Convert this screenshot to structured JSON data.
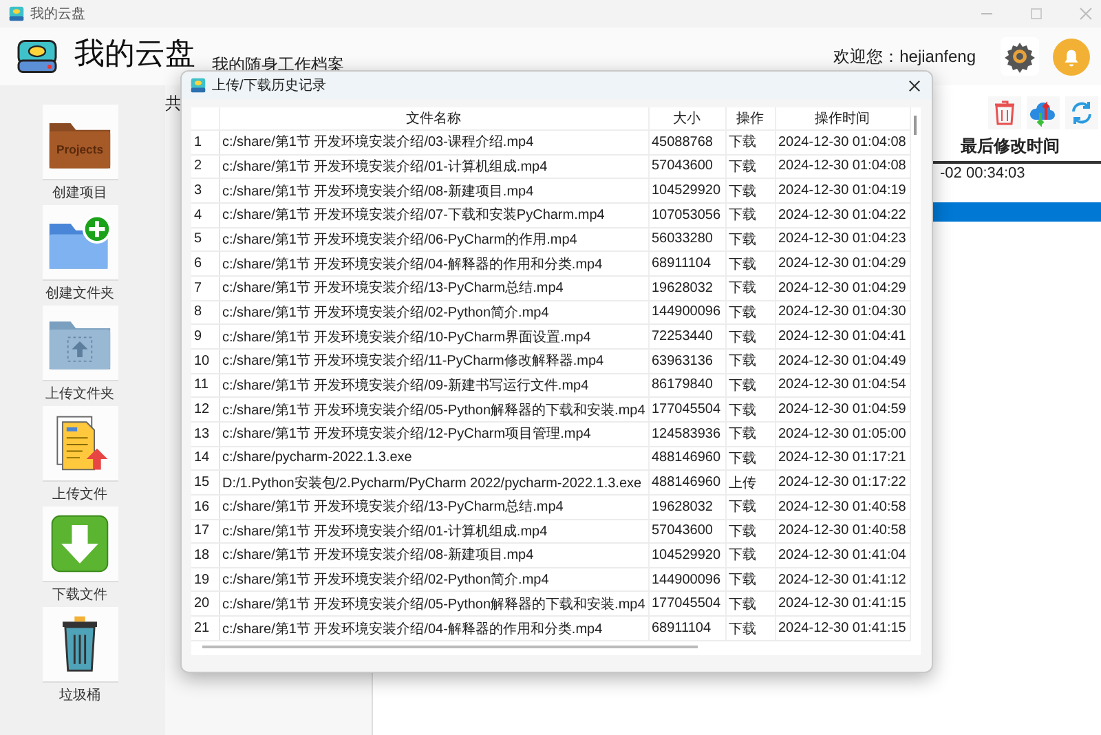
{
  "window": {
    "title": "我的云盘"
  },
  "header": {
    "title": "我的云盘",
    "subtitle": "我的随身工作档案",
    "welcome": "欢迎您：hejianfeng"
  },
  "toolbar": [
    {
      "label": "创建项目",
      "kind": "projects",
      "icon_text": "Projects"
    },
    {
      "label": "创建文件夹",
      "kind": "new-folder"
    },
    {
      "label": "上传文件夹",
      "kind": "upload-folder"
    },
    {
      "label": "上传文件",
      "kind": "upload-file"
    },
    {
      "label": "下载文件",
      "kind": "download"
    },
    {
      "label": "垃圾桶",
      "kind": "trash"
    }
  ],
  "shared_panel": {
    "heading": "共"
  },
  "file_list": {
    "columns": [
      "最后修改时间"
    ],
    "rows": [
      {
        "modified": "-02 00:34:03",
        "selected": false
      },
      {
        "selected": false
      },
      {
        "selected": true
      }
    ]
  },
  "dialog": {
    "title": "上传/下载历史记录",
    "columns": [
      "文件名称",
      "大小",
      "操作",
      "操作时间"
    ],
    "rows": [
      {
        "index": "1",
        "name": "c:/share/第1节 开发环境安装介绍/03-课程介绍.mp4",
        "size": "45088768",
        "action": "下载",
        "time": "2024-12-30 01:04:08"
      },
      {
        "index": "2",
        "name": "c:/share/第1节 开发环境安装介绍/01-计算机组成.mp4",
        "size": "57043600",
        "action": "下载",
        "time": "2024-12-30 01:04:08"
      },
      {
        "index": "3",
        "name": "c:/share/第1节 开发环境安装介绍/08-新建项目.mp4",
        "size": "104529920",
        "action": "下载",
        "time": "2024-12-30 01:04:19"
      },
      {
        "index": "4",
        "name": "c:/share/第1节 开发环境安装介绍/07-下载和安装PyCharm.mp4",
        "size": "107053056",
        "action": "下载",
        "time": "2024-12-30 01:04:22"
      },
      {
        "index": "5",
        "name": "c:/share/第1节 开发环境安装介绍/06-PyCharm的作用.mp4",
        "size": "56033280",
        "action": "下载",
        "time": "2024-12-30 01:04:23"
      },
      {
        "index": "6",
        "name": "c:/share/第1节 开发环境安装介绍/04-解释器的作用和分类.mp4",
        "size": "68911104",
        "action": "下载",
        "time": "2024-12-30 01:04:29"
      },
      {
        "index": "7",
        "name": "c:/share/第1节 开发环境安装介绍/13-PyCharm总结.mp4",
        "size": "19628032",
        "action": "下载",
        "time": "2024-12-30 01:04:29"
      },
      {
        "index": "8",
        "name": "c:/share/第1节 开发环境安装介绍/02-Python简介.mp4",
        "size": "144900096",
        "action": "下载",
        "time": "2024-12-30 01:04:30"
      },
      {
        "index": "9",
        "name": "c:/share/第1节 开发环境安装介绍/10-PyCharm界面设置.mp4",
        "size": "72253440",
        "action": "下载",
        "time": "2024-12-30 01:04:41"
      },
      {
        "index": "10",
        "name": "c:/share/第1节 开发环境安装介绍/11-PyCharm修改解释器.mp4",
        "size": "63963136",
        "action": "下载",
        "time": "2024-12-30 01:04:49"
      },
      {
        "index": "11",
        "name": "c:/share/第1节 开发环境安装介绍/09-新建书写运行文件.mp4",
        "size": "86179840",
        "action": "下载",
        "time": "2024-12-30 01:04:54"
      },
      {
        "index": "12",
        "name": "c:/share/第1节 开发环境安装介绍/05-Python解释器的下载和安装.mp4",
        "size": "177045504",
        "action": "下载",
        "time": "2024-12-30 01:04:59"
      },
      {
        "index": "13",
        "name": "c:/share/第1节 开发环境安装介绍/12-PyCharm项目管理.mp4",
        "size": "124583936",
        "action": "下载",
        "time": "2024-12-30 01:05:00"
      },
      {
        "index": "14",
        "name": "c:/share/pycharm-2022.1.3.exe",
        "size": "488146960",
        "action": "下载",
        "time": "2024-12-30 01:17:21"
      },
      {
        "index": "15",
        "name": "D:/1.Python安装包/2.Pycharm/PyCharm 2022/pycharm-2022.1.3.exe",
        "size": "488146960",
        "action": "上传",
        "time": "2024-12-30 01:17:22"
      },
      {
        "index": "16",
        "name": "c:/share/第1节 开发环境安装介绍/13-PyCharm总结.mp4",
        "size": "19628032",
        "action": "下载",
        "time": "2024-12-30 01:40:58"
      },
      {
        "index": "17",
        "name": "c:/share/第1节 开发环境安装介绍/01-计算机组成.mp4",
        "size": "57043600",
        "action": "下载",
        "time": "2024-12-30 01:40:58"
      },
      {
        "index": "18",
        "name": "c:/share/第1节 开发环境安装介绍/08-新建项目.mp4",
        "size": "104529920",
        "action": "下载",
        "time": "2024-12-30 01:41:04"
      },
      {
        "index": "19",
        "name": "c:/share/第1节 开发环境安装介绍/02-Python简介.mp4",
        "size": "144900096",
        "action": "下载",
        "time": "2024-12-30 01:41:12"
      },
      {
        "index": "20",
        "name": "c:/share/第1节 开发环境安装介绍/05-Python解释器的下载和安装.mp4",
        "size": "177045504",
        "action": "下载",
        "time": "2024-12-30 01:41:15"
      },
      {
        "index": "21",
        "name": "c:/share/第1节 开发环境安装介绍/04-解释器的作用和分类.mp4",
        "size": "68911104",
        "action": "下载",
        "time": "2024-12-30 01:41:15"
      }
    ]
  }
}
